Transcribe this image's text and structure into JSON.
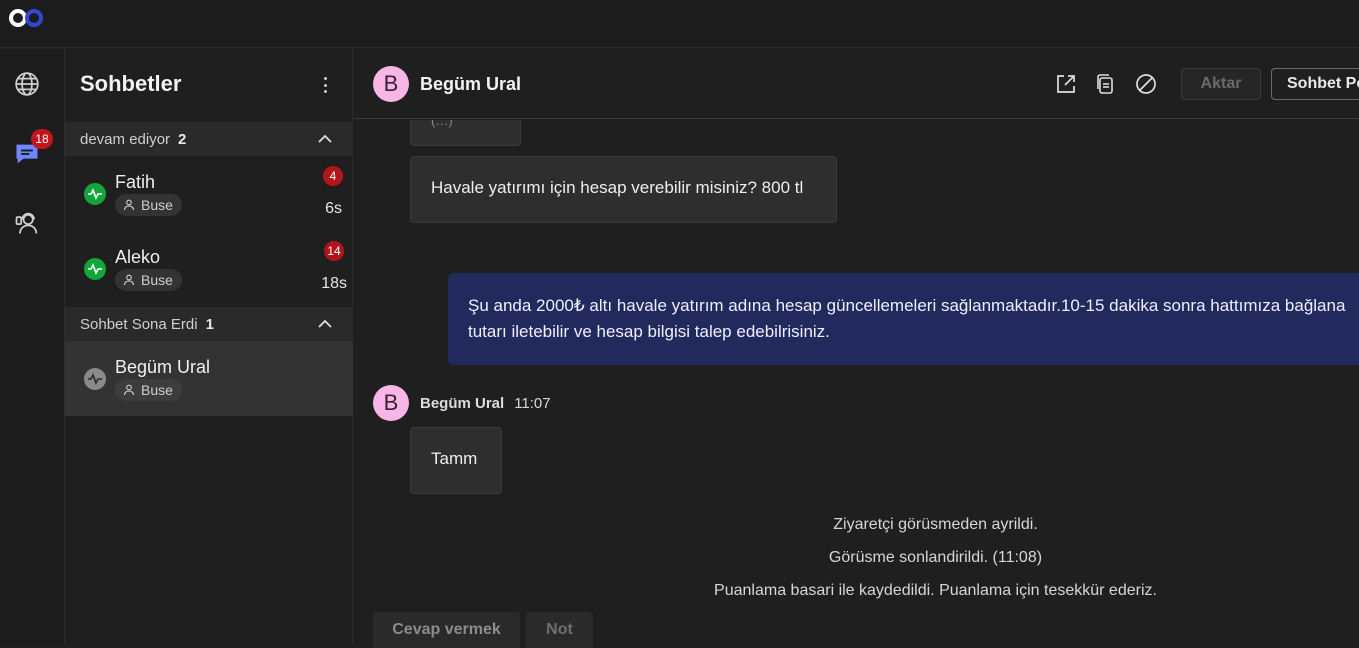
{
  "colors": {
    "accent": "#2b49d6",
    "online": "#12a63a",
    "offline": "#8a8a8a",
    "badge": "#c0161b",
    "outgoing_bubble": "#22295c",
    "avatar": "#f7b6e6"
  },
  "rail": {
    "badge": "18",
    "icons": [
      "globe-icon",
      "chat-icon",
      "support-agent-icon"
    ]
  },
  "sidebar": {
    "title": "Sohbetler",
    "groups": [
      {
        "label": "devam ediyor",
        "count": "2"
      },
      {
        "label": "Sohbet Sona Erdi",
        "count": "1"
      }
    ],
    "chats": [
      {
        "name": "Fatih",
        "agent": "Buse",
        "unread": "4",
        "time": "6s",
        "status": "online"
      },
      {
        "name": "Aleko",
        "agent": "Buse",
        "unread": "14",
        "time": "18s",
        "status": "online"
      },
      {
        "name": "Begüm Ural",
        "agent": "Buse",
        "status": "offline"
      }
    ]
  },
  "header": {
    "avatar_letter": "B",
    "name": "Begüm Ural",
    "icons": [
      "open-external-icon",
      "copy-icon",
      "block-icon"
    ],
    "transfer_label": "Aktar",
    "close_chat_label": "Sohbet Po"
  },
  "messages": {
    "partial_top": "(…)",
    "incoming_1": "Havale yatırımı için hesap verebilir misiniz? 800 tl",
    "outgoing_line1": "Şu anda 2000₺ altı havale yatırım adına hesap güncellemeleri sağlanmaktadır.10-15 dakika sonra hattımıza bağlana",
    "outgoing_line2": "tutarı iletebilir ve hesap bilgisi talep edebilrisiniz.",
    "sender_letter": "B",
    "sender_name": "Begüm Ural",
    "sender_time": "11:07",
    "incoming_2": "Tamm"
  },
  "system": [
    "Ziyaretçi görüsmeden ayrildi.",
    "Görüsme sonlandirildi. (11:08)",
    "Puanlama basari ile kaydedildi. Puanlama için tesekkür ederiz."
  ],
  "tabs": {
    "reply": "Cevap vermek",
    "note": "Not"
  }
}
